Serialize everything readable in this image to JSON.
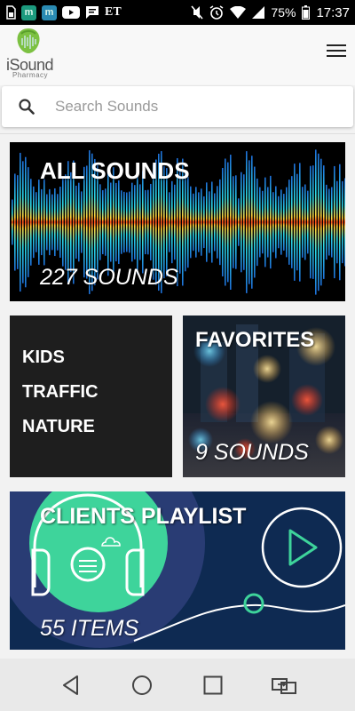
{
  "status_bar": {
    "app_icon_1": "m",
    "app_icon_2": "m",
    "et_label": "ET",
    "battery_percent": "75%",
    "time": "17:37",
    "icons": [
      "sim-icon",
      "app-m-icon",
      "app-m-icon",
      "youtube-icon",
      "message-icon",
      "mute-icon",
      "alarm-icon",
      "wifi-icon",
      "signal-icon",
      "battery-icon"
    ]
  },
  "header": {
    "logo_text": "iSound",
    "logo_subtext": "Pharmacy",
    "menu_icon": "hamburger-icon"
  },
  "search": {
    "placeholder": "Search Sounds",
    "value": ""
  },
  "cards": {
    "all_sounds": {
      "title": "ALL SOUNDS",
      "count": "227 SOUNDS"
    },
    "categories": {
      "items": [
        "KIDS",
        "TRAFFIC",
        "NATURE"
      ]
    },
    "favorites": {
      "title": "FAVORITES",
      "count": "9 SOUNDS"
    },
    "playlist": {
      "title": "CLIENTS PLAYLIST",
      "count": "55 ITEMS"
    }
  },
  "nav_bar": {
    "buttons": [
      "back-icon",
      "home-icon",
      "recents-icon",
      "screen-mirror-icon"
    ]
  },
  "colors": {
    "accent_green": "#3ed49b",
    "playlist_bg": "#0e2a52",
    "logo_green": "#7cc142"
  }
}
